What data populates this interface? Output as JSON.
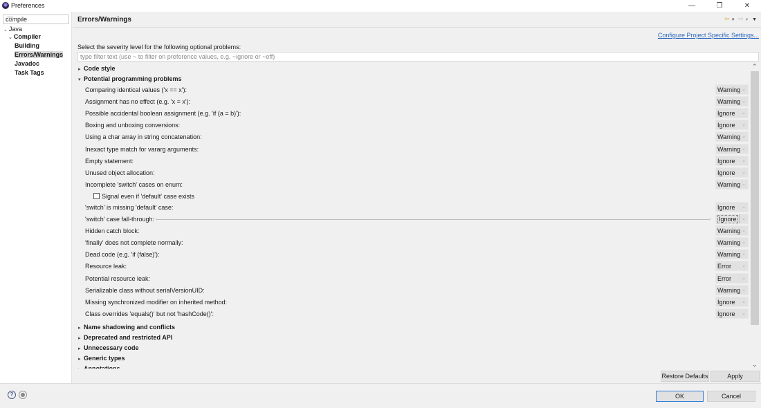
{
  "window": {
    "title": "Preferences",
    "controls": [
      "—",
      "❐",
      "✕"
    ]
  },
  "sidebar": {
    "filter_value": "compile",
    "tree": [
      {
        "label": "Java",
        "level": 0,
        "bold": false,
        "twisty": "expanded"
      },
      {
        "label": "Compiler",
        "level": 1,
        "bold": true,
        "twisty": "expanded"
      },
      {
        "label": "Building",
        "level": 2,
        "bold": true
      },
      {
        "label": "Errors/Warnings",
        "level": 2,
        "bold": true,
        "selected": true
      },
      {
        "label": "Javadoc",
        "level": 2,
        "bold": true
      },
      {
        "label": "Task Tags",
        "level": 2,
        "bold": true
      }
    ]
  },
  "page": {
    "title": "Errors/Warnings",
    "nav_icons": [
      "back-arrow-icon",
      "dropdown-icon",
      "forward-arrow-icon",
      "dropdown-icon",
      "menu-icon"
    ],
    "configure_link": "Configure Project Specific Settings...",
    "instruction": "Select the severity level for the following optional problems:",
    "filter_placeholder": "type filter text (use ~ to filter on preference values, e.g. ~ignore or ~off)",
    "sections": [
      {
        "label": "Code style",
        "expanded": false
      },
      {
        "label": "Potential programming problems",
        "expanded": true,
        "options": [
          {
            "label": "Comparing identical values ('x == x'):",
            "value": "Warning"
          },
          {
            "label": "Assignment has no effect (e.g. 'x = x'):",
            "value": "Warning"
          },
          {
            "label": "Possible accidental boolean assignment (e.g. 'if (a = b)'):",
            "value": "Ignore"
          },
          {
            "label": "Boxing and unboxing conversions:",
            "value": "Ignore"
          },
          {
            "label": "Using a char array in string concatenation:",
            "value": "Warning"
          },
          {
            "label": "Inexact type match for vararg arguments:",
            "value": "Warning"
          },
          {
            "label": "Empty statement:",
            "value": "Ignore"
          },
          {
            "label": "Unused object allocation:",
            "value": "Ignore"
          },
          {
            "label": "Incomplete 'switch' cases on enum:",
            "value": "Warning"
          },
          {
            "label": "Signal even if 'default' case exists",
            "checkbox": true,
            "checked": false
          },
          {
            "label": "'switch' is missing 'default' case:",
            "value": "Ignore"
          },
          {
            "label": "'switch' case fall-through:",
            "value": "Ignore",
            "focused": true
          },
          {
            "label": "Hidden catch block:",
            "value": "Warning"
          },
          {
            "label": "'finally' does not complete normally:",
            "value": "Warning"
          },
          {
            "label": "Dead code (e.g. 'if (false)'):",
            "value": "Warning"
          },
          {
            "label": "Resource leak:",
            "value": "Error"
          },
          {
            "label": "Potential resource leak:",
            "value": "Error"
          },
          {
            "label": "Serializable class without serialVersionUID:",
            "value": "Warning"
          },
          {
            "label": "Missing synchronized modifier on inherited method:",
            "value": "Ignore"
          },
          {
            "label": "Class overrides 'equals()' but not 'hashCode()':",
            "value": "Ignore"
          }
        ]
      },
      {
        "label": "Name shadowing and conflicts",
        "expanded": false
      },
      {
        "label": "Deprecated and restricted API",
        "expanded": false
      },
      {
        "label": "Unnecessary code",
        "expanded": false
      },
      {
        "label": "Generic types",
        "expanded": false
      },
      {
        "label": "Annotations",
        "expanded": false
      }
    ],
    "restore_defaults": "Restore Defaults",
    "apply": "Apply"
  },
  "footer": {
    "ok": "OK",
    "cancel": "Cancel",
    "help_icon": "help-icon",
    "record_icon": "record-icon"
  }
}
